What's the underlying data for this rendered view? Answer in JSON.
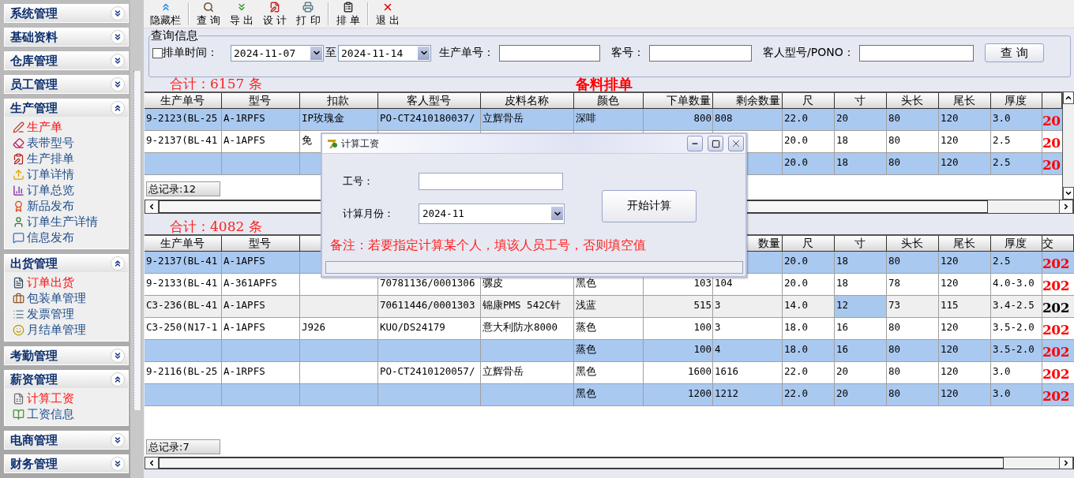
{
  "sidebar": {
    "groups": [
      {
        "title": "系统管理",
        "expanded": false
      },
      {
        "title": "基础资料",
        "expanded": false
      },
      {
        "title": "仓库管理",
        "expanded": false
      },
      {
        "title": "员工管理",
        "expanded": false
      },
      {
        "title": "生产管理",
        "expanded": true,
        "items": [
          {
            "label": "生产单",
            "selected": true
          },
          {
            "label": "表带型号",
            "selected": false
          },
          {
            "label": "生产排单",
            "selected": false
          },
          {
            "label": "订单详情",
            "selected": false
          },
          {
            "label": "订单总览",
            "selected": false
          },
          {
            "label": "新品发布",
            "selected": false
          },
          {
            "label": "订单生产详情",
            "selected": false
          },
          {
            "label": "信息发布",
            "selected": false
          }
        ]
      },
      {
        "title": "出货管理",
        "expanded": true,
        "items": [
          {
            "label": "订单出货",
            "selected": true
          },
          {
            "label": "包装单管理",
            "selected": false
          },
          {
            "label": "发票管理",
            "selected": false
          },
          {
            "label": "月结单管理",
            "selected": false
          }
        ]
      },
      {
        "title": "考勤管理",
        "expanded": false
      },
      {
        "title": "薪资管理",
        "expanded": true,
        "items": [
          {
            "label": "计算工资",
            "selected": true
          },
          {
            "label": "工资信息",
            "selected": false
          }
        ]
      },
      {
        "title": "电商管理",
        "expanded": false
      },
      {
        "title": "财务管理",
        "expanded": false
      }
    ]
  },
  "toolbar": {
    "buttons": [
      {
        "label": "隐藏栏",
        "separator_after": true
      },
      {
        "label": "查 询",
        "separator_after": false
      },
      {
        "label": "导 出",
        "separator_after": false
      },
      {
        "label": "设 计",
        "separator_after": false
      },
      {
        "label": "打 印",
        "separator_after": true
      },
      {
        "label": "排 单",
        "separator_after": true
      },
      {
        "label": "退 出",
        "separator_after": false
      }
    ]
  },
  "query": {
    "title": "查询信息",
    "schedule_time": {
      "label": "排单时间：",
      "checked": false
    },
    "date_from": "2024-11-07",
    "to_label": "至",
    "date_to": "2024-11-14",
    "fields": [
      {
        "label": "生产单号："
      },
      {
        "label": "客号："
      },
      {
        "label": "客人型号/PONO："
      }
    ],
    "search_button": "查 询"
  },
  "schedule": {
    "total": "合计：6157 条",
    "title": "备料排单",
    "columns": [
      "生产单号",
      "型号",
      "扣款",
      "客人型号",
      "皮料名称",
      "颜色",
      "下单数量",
      "剩余数量",
      "尺",
      "寸",
      "头长",
      "尾长",
      "厚度"
    ],
    "rows": [
      {
        "selected": true,
        "current": false,
        "cells": [
          "9-2123(BL-25",
          "A-1RPFS",
          "IP玫瑰金",
          "PO-CT2410180037/",
          "立辉骨岳",
          "深啡",
          "800",
          "808",
          "22.0",
          "20",
          "80",
          "120",
          "3.0"
        ],
        "date": {
          "text": "20",
          "color": "#ff0000"
        }
      },
      {
        "selected": false,
        "current": false,
        "cells": [
          "9-2137(BL-41",
          "A-1APFS",
          "免",
          null,
          null,
          null,
          null,
          null,
          "20.0",
          "18",
          "80",
          "120",
          "2.5"
        ],
        "date": {
          "text": "20",
          "color": "#ff0000"
        }
      },
      {
        "selected": true,
        "current": false,
        "cells": [
          null,
          null,
          null,
          null,
          null,
          null,
          null,
          null,
          "20.0",
          "18",
          "80",
          "120",
          "2.5"
        ],
        "date": {
          "text": "20",
          "color": "#ff0000"
        }
      }
    ],
    "record_count": "总记录:12"
  },
  "details": {
    "total": "合计：4082 条",
    "columns": [
      "生产单号",
      "型号",
      null,
      null,
      null,
      null,
      null,
      "数量",
      "尺",
      "寸",
      "头长",
      "尾长",
      "厚度"
    ],
    "date_column": "交",
    "rows": [
      {
        "selected": true,
        "current": false,
        "cells": [
          "9-2137(BL-41",
          "A-1APFS",
          null,
          null,
          null,
          null,
          null,
          null,
          "20.0",
          "18",
          "80",
          "120",
          "2.5"
        ],
        "date": {
          "text": "202",
          "color": "#ff0000"
        }
      },
      {
        "selected": false,
        "current": false,
        "cells": [
          "9-2133(BL-41",
          "A-361APFS",
          null,
          "70781136/0001306",
          "骡皮",
          "黑色",
          "103",
          "104",
          "20.0",
          "18",
          "78",
          "120",
          "4.0-3.0"
        ],
        "date": {
          "text": "202",
          "color": "#ff0000"
        }
      },
      {
        "selected": false,
        "current": true,
        "cells": [
          "C3-236(BL-41",
          "A-1APFS",
          null,
          "70611446/0001303",
          "锦康PMS 542C针",
          "浅蓝",
          "515",
          "3",
          "14.0",
          {
            "text": "12",
            "focused": true
          },
          "73",
          "115",
          "3.4-2.5"
        ],
        "date": {
          "text": "202",
          "color": "#000000"
        }
      },
      {
        "selected": false,
        "current": false,
        "cells": [
          "C3-250(N17-1",
          "A-1APFS",
          "J926",
          "KUO/DS24179",
          "意大利防水8000",
          "蒸色",
          "100",
          "3",
          "18.0",
          "16",
          "80",
          "120",
          "3.5-2.0"
        ],
        "date": {
          "text": "202",
          "color": "#ff0000"
        }
      },
      {
        "selected": true,
        "current": false,
        "cells": [
          null,
          null,
          null,
          null,
          null,
          "蒸色",
          "100",
          "4",
          "18.0",
          "16",
          "80",
          "120",
          "3.5-2.0"
        ],
        "date": {
          "text": "202",
          "color": "#ff0000"
        }
      },
      {
        "selected": false,
        "current": false,
        "cells": [
          "9-2116(BL-25",
          "A-1RPFS",
          null,
          "PO-CT2410120057/",
          "立辉骨岳",
          "黑色",
          "1600",
          "1616",
          "22.0",
          "20",
          "80",
          "120",
          "3.0"
        ],
        "date": {
          "text": "202",
          "color": "#ff0000"
        }
      },
      {
        "selected": true,
        "current": false,
        "cells": [
          null,
          null,
          null,
          null,
          null,
          "黑色",
          "1200",
          "1212",
          "22.0",
          "20",
          "80",
          "120",
          "3.0"
        ],
        "date": {
          "text": "202",
          "color": "#ff0000"
        }
      }
    ],
    "record_count": "总记录:7"
  },
  "dialog": {
    "title": "计算工资",
    "employee_label": "工号：",
    "month_label": "计算月份：",
    "month": "2024-11",
    "start_button": "开始计算",
    "note": "备注：若要指定计算某个人，填该人员工号，否则填空值"
  }
}
